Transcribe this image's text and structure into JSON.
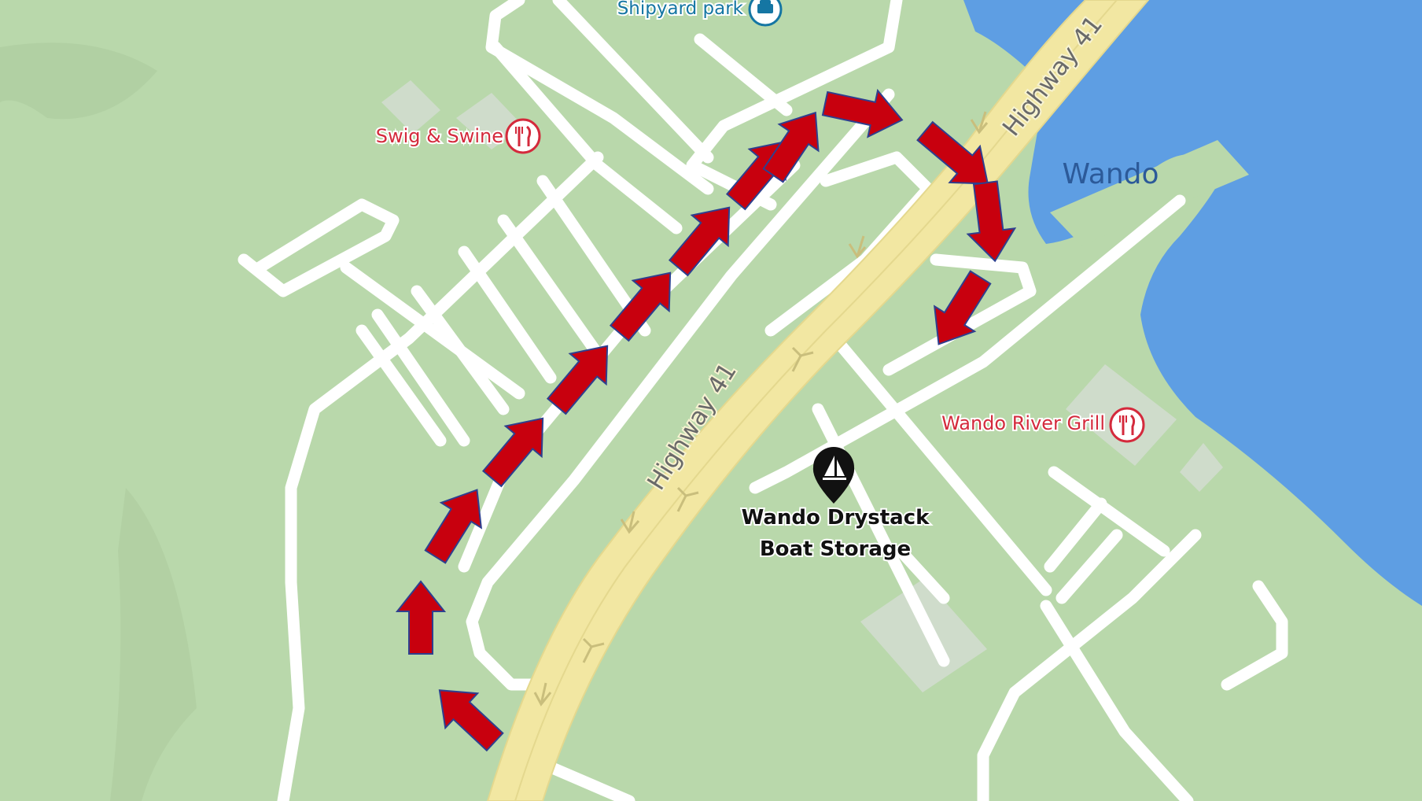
{
  "map": {
    "water_label": "Wando",
    "highway_labels": [
      "Highway 41",
      "Highway 41"
    ],
    "pois": {
      "shipyard_park": {
        "label": "Shipyard park",
        "icon": "playground-icon"
      },
      "swig_swine": {
        "label": "Swig & Swine",
        "icon": "restaurant-icon"
      },
      "wando_river_grill": {
        "label": "Wando River Grill",
        "icon": "restaurant-icon"
      },
      "drystack": {
        "line1": "Wando Drystack",
        "line2": "Boat Storage",
        "icon": "sailboat-pin-icon"
      }
    },
    "colors": {
      "land": "#b9d8ab",
      "water": "#5e9ee3",
      "highway": "#f2e7a2",
      "road": "#ffffff",
      "poi_red": "#d42a3c",
      "poi_blue": "#1576a3",
      "arrow_fill": "#c8000e",
      "arrow_outline": "#2e3f8f"
    },
    "route_arrows": 14
  }
}
